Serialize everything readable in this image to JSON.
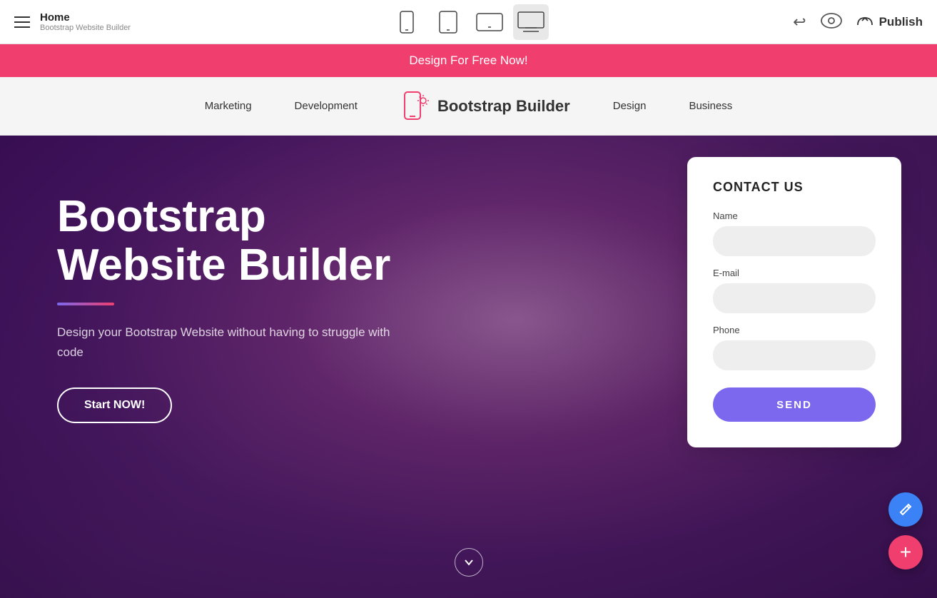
{
  "topbar": {
    "title": "Home",
    "subtitle": "Bootstrap Website Builder",
    "hamburger_label": "menu",
    "undo_symbol": "↩",
    "publish_label": "Publish"
  },
  "promo": {
    "text": "Design For Free Now!"
  },
  "sitenav": {
    "items": [
      {
        "label": "Marketing"
      },
      {
        "label": "Development"
      },
      {
        "label": "Design"
      },
      {
        "label": "Business"
      }
    ],
    "logo_text": "Bootstrap Builder"
  },
  "hero": {
    "title_line1": "Bootstrap",
    "title_line2": "Website Builder",
    "description": "Design your Bootstrap Website without having to struggle with code",
    "cta_label": "Start NOW!"
  },
  "contact": {
    "heading": "CONTACT US",
    "name_label": "Name",
    "name_placeholder": "",
    "email_label": "E-mail",
    "email_placeholder": "",
    "phone_label": "Phone",
    "phone_placeholder": "",
    "send_label": "SEND"
  },
  "devices": {
    "mobile_label": "mobile",
    "tablet_label": "tablet",
    "tablet_landscape_label": "tablet-landscape",
    "desktop_label": "desktop"
  },
  "fab": {
    "edit_label": "edit",
    "add_label": "add"
  }
}
